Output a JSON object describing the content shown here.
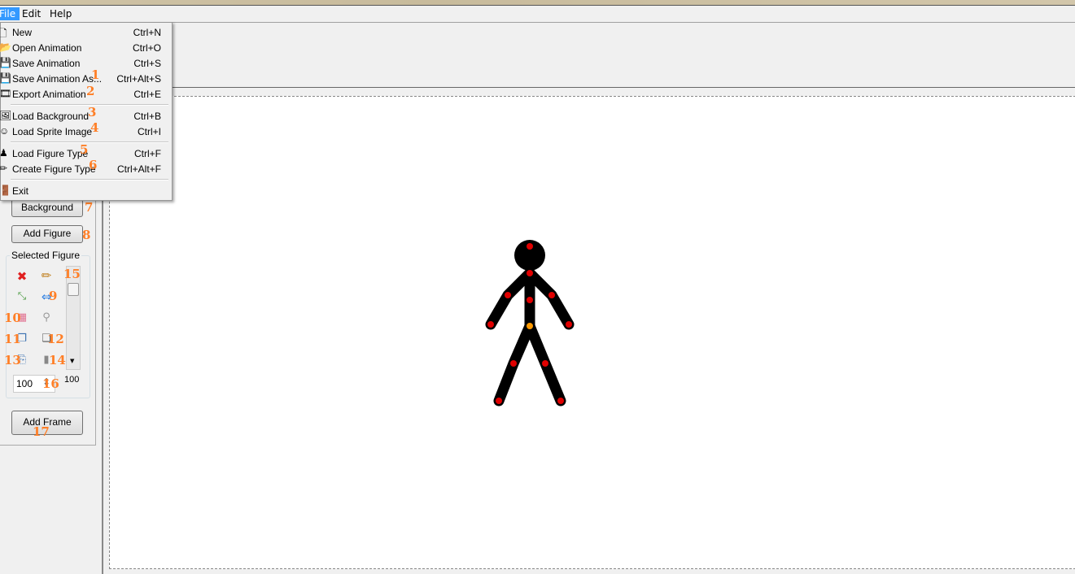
{
  "menubar": {
    "items": [
      "File",
      "Edit",
      "Help"
    ]
  },
  "file_menu": [
    {
      "label": "New",
      "shortcut": "Ctrl+N",
      "icon": "new-file-icon"
    },
    {
      "label": "Open Animation",
      "shortcut": "Ctrl+O",
      "icon": "open-icon"
    },
    {
      "label": "Save Animation",
      "shortcut": "Ctrl+S",
      "icon": "save-icon"
    },
    {
      "label": "Save Animation As...",
      "shortcut": "Ctrl+Alt+S",
      "icon": "save-as-icon",
      "marker": "1"
    },
    {
      "label": "Export Animation",
      "shortcut": "Ctrl+E",
      "icon": "film-icon",
      "marker": "2"
    },
    {
      "label": "Load Background",
      "shortcut": "Ctrl+B",
      "icon": "background-icon",
      "marker": "3"
    },
    {
      "label": "Load Sprite Image",
      "shortcut": "Ctrl+I",
      "icon": "smiley-icon",
      "marker": "4"
    },
    {
      "label": "Load Figure Type",
      "shortcut": "Ctrl+F",
      "icon": "figure-icon",
      "marker": "5"
    },
    {
      "label": "Create Figure Type",
      "shortcut": "Ctrl+Alt+F",
      "icon": "pencil-icon",
      "marker": "6"
    },
    {
      "label": "Exit",
      "shortcut": "",
      "icon": "exit-icon"
    }
  ],
  "left_panel": {
    "background_button": "Background",
    "background_marker": "7",
    "add_figure_button": "Add Figure",
    "add_figure_marker": "8",
    "group_title": "Selected Figure",
    "markers": {
      "flip": "9",
      "color": "10",
      "front": "11",
      "back": "12",
      "copy": "13",
      "paste": "14",
      "scroll": "15",
      "scale": "16",
      "add_frame": "17"
    },
    "scale_value": "100",
    "scale_label": "100",
    "add_frame_button": "Add Frame"
  },
  "colors": {
    "accent": "#ff7f27",
    "joint": "#e00000",
    "root_joint": "#ff9900"
  }
}
